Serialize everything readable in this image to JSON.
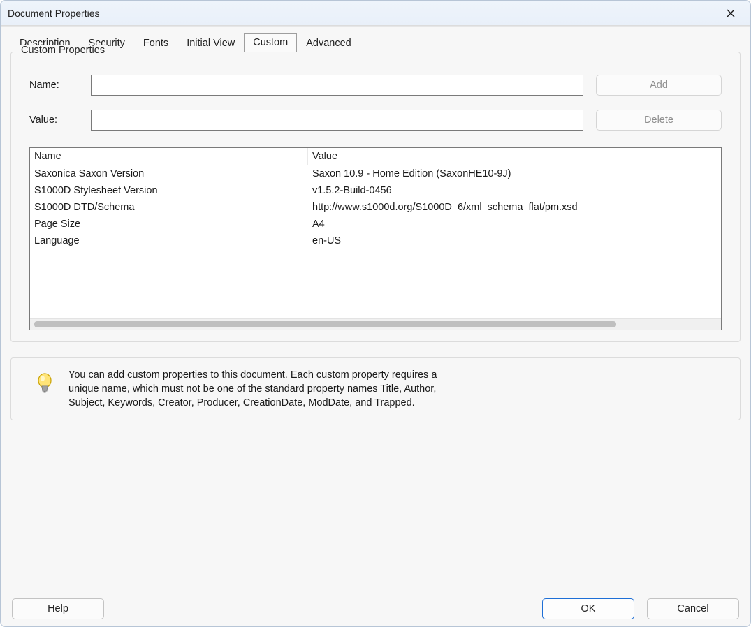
{
  "window": {
    "title": "Document Properties"
  },
  "tabs": {
    "items": [
      {
        "label": "Description",
        "active": false
      },
      {
        "label": "Security",
        "active": false
      },
      {
        "label": "Fonts",
        "active": false
      },
      {
        "label": "Initial View",
        "active": false
      },
      {
        "label": "Custom",
        "active": true
      },
      {
        "label": "Advanced",
        "active": false
      }
    ]
  },
  "fieldset": {
    "legend": "Custom Properties"
  },
  "form": {
    "name_label_prefix": "N",
    "name_label_rest": "ame:",
    "name_value": "",
    "value_label_prefix": "V",
    "value_label_rest": "alue:",
    "value_value": "",
    "add_label": "Add",
    "delete_label": "Delete",
    "add_enabled": false,
    "delete_enabled": false
  },
  "table": {
    "columns": {
      "name": "Name",
      "value": "Value"
    },
    "rows": [
      {
        "name": "Saxonica Saxon Version",
        "value": "Saxon 10.9 - Home Edition (SaxonHE10-9J)"
      },
      {
        "name": "S1000D Stylesheet Version",
        "value": "v1.5.2-Build-0456"
      },
      {
        "name": "S1000D DTD/Schema",
        "value": "http://www.s1000d.org/S1000D_6/xml_schema_flat/pm.xsd"
      },
      {
        "name": "Page Size",
        "value": "A4"
      },
      {
        "name": "Language",
        "value": "en-US"
      }
    ]
  },
  "info": {
    "text": "You can add custom properties to this document. Each custom property requires a unique name, which must not be one of the standard property names Title, Author, Subject, Keywords, Creator, Producer, CreationDate, ModDate, and Trapped."
  },
  "footer": {
    "help_label": "Help",
    "ok_label": "OK",
    "cancel_label": "Cancel"
  }
}
